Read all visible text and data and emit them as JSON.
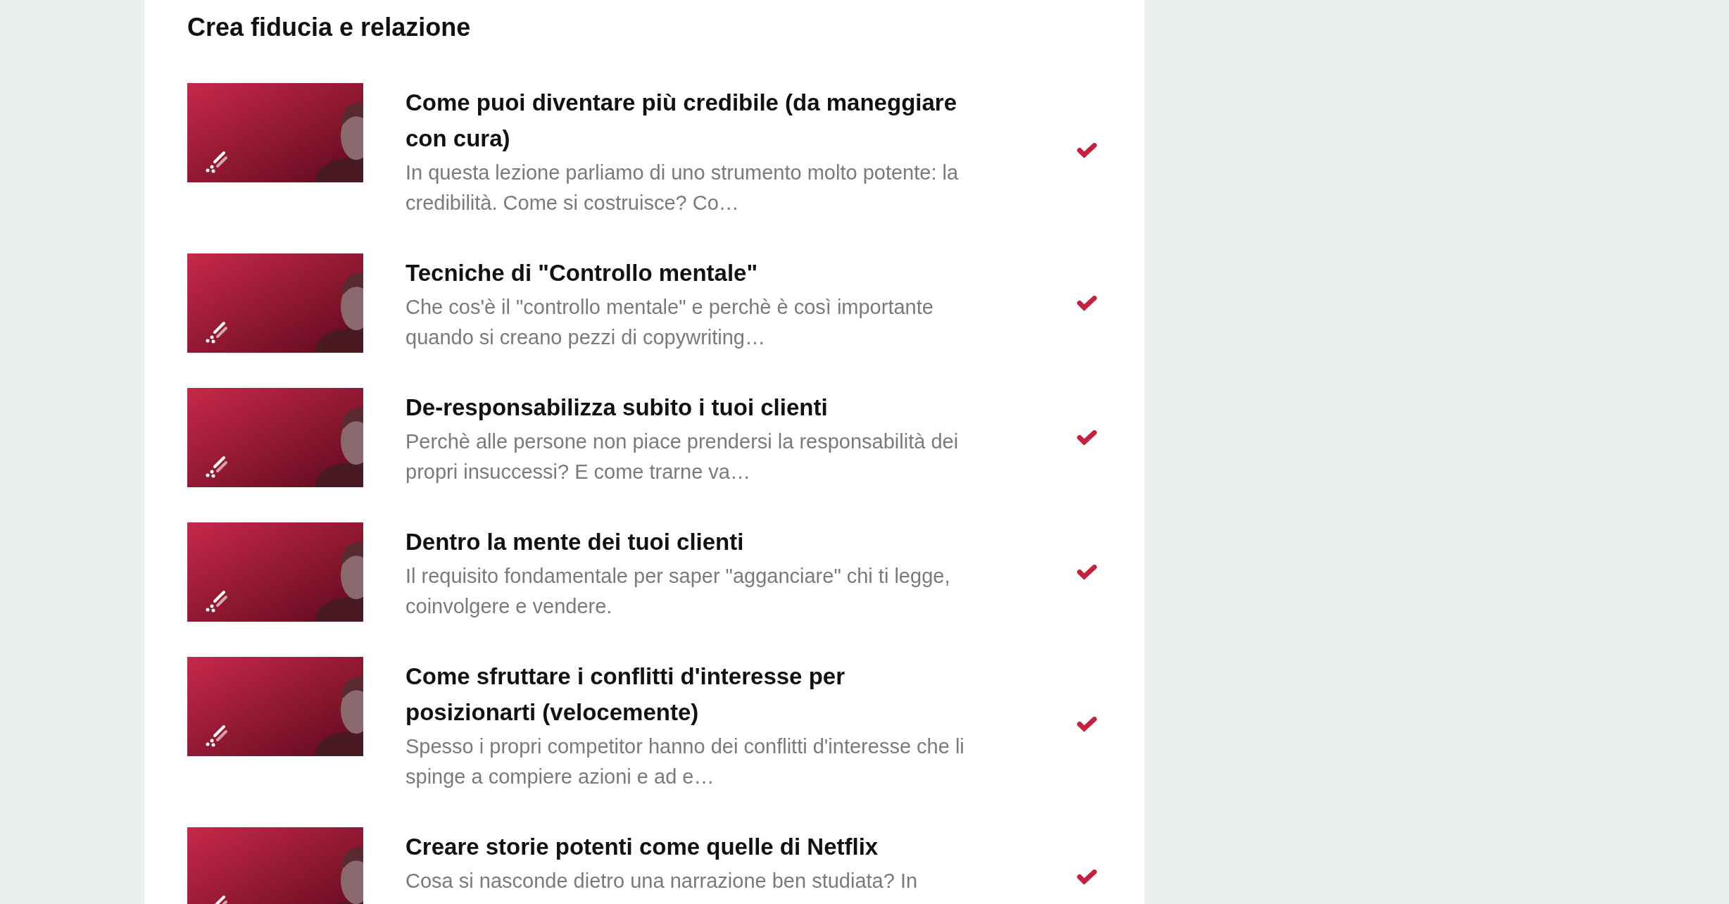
{
  "section": {
    "title": "Crea fiducia e relazione"
  },
  "lessons": [
    {
      "title": "Come puoi diventare più credibile (da maneggiare con cura)",
      "description": "In questa lezione parliamo di uno strumento molto potente: la credibilità. Come si costruisce? Co…",
      "completed": true
    },
    {
      "title": "Tecniche di \"Controllo mentale\"",
      "description": "Che cos'è il \"controllo mentale\" e perchè è così importante quando si creano pezzi di copywriting…",
      "completed": true
    },
    {
      "title": "De-responsabilizza subito i tuoi clienti",
      "description": "Perchè alle persone non piace prendersi la responsabilità dei propri insuccessi? E come trarne va…",
      "completed": true
    },
    {
      "title": "Dentro la mente dei tuoi clienti",
      "description": "Il requisito fondamentale per saper \"agganciare\" chi ti legge, coinvolgere e vendere.",
      "completed": true
    },
    {
      "title": "Come sfruttare i conflitti d'interesse per posizionarti (velocemente)",
      "description": "Spesso i propri competitor hanno dei conflitti d'interesse che li spinge a compiere azioni e ad e…",
      "completed": true
    },
    {
      "title": "Creare storie potenti come quelle di Netflix",
      "description": "Cosa si nasconde dietro una narrazione ben studiata? In",
      "completed": true
    }
  ]
}
